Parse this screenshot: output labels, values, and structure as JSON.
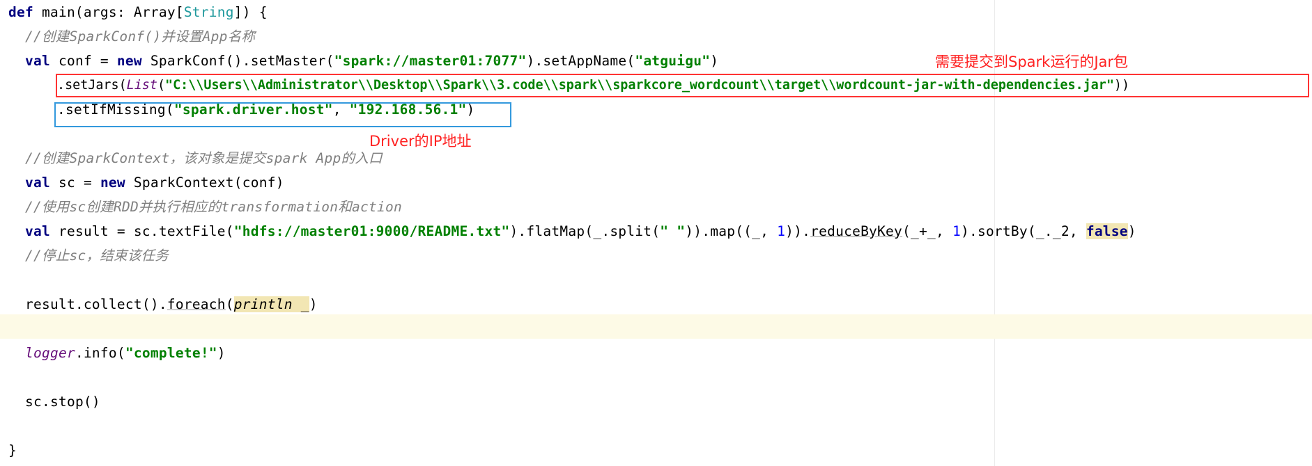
{
  "code": {
    "l1": {
      "def": "def",
      "rest": " main(args: Array[",
      "type": "String",
      "close": "]) {"
    },
    "c1": "//创建SparkConf()并设置App名称",
    "l3": {
      "val": "val",
      "a": " conf = ",
      "new": "new",
      "b": " SparkConf().setMaster(",
      "s1": "\"spark://master01:7077\"",
      "c": ").setAppName(",
      "s2": "\"atguigu\"",
      "d": ")"
    },
    "l4": {
      "a": ".setJars(",
      "list": "List",
      "b": "(",
      "s": "\"C:\\\\Users\\\\Administrator\\\\Desktop\\\\Spark\\\\3.code\\\\spark\\\\sparkcore_wordcount\\\\target\\\\wordcount-jar-with-dependencies.jar\"",
      "c": "))"
    },
    "l5": {
      "a": ".setIfMissing(",
      "s1": "\"spark.driver.host\"",
      "b": ", ",
      "s2": "\"192.168.56.1\"",
      "c": ")"
    },
    "c2": "//创建SparkContext，该对象是提交spark App的入口",
    "l7": {
      "val": "val",
      "a": " sc = ",
      "new": "new",
      "b": " SparkContext(conf)"
    },
    "c3": "//使用sc创建RDD并执行相应的transformation和action",
    "l9": {
      "val": "val",
      "a": " result = sc.textFile(",
      "s1": "\"hdfs://master01:9000/README.txt\"",
      "b": ").flatMap(_.split(",
      "s2": "\" \"",
      "c": ")).map((_, ",
      "n1": "1",
      "d": ")).",
      "rbk": "reduceByKey",
      "e": "(_+_, ",
      "n2": "1",
      "f": ").sortBy(_._2, ",
      "false": "false",
      "g": ")"
    },
    "c4": "//停止sc，结束该任务",
    "l12": {
      "a": "result.collect().",
      "fe": "foreach",
      "b": "(",
      "pl": "println _",
      "c": ")"
    },
    "l14": {
      "lg": "logger",
      "a": ".info(",
      "s": "\"complete!\"",
      "b": ")"
    },
    "l16": "sc.stop()",
    "l18": "}"
  },
  "annotations": {
    "jar_note": "需要提交到Spark运行的Jar包",
    "driver_note": "Driver的IP地址"
  },
  "colors": {
    "keyword": "#000080",
    "string": "#008000",
    "number": "#0000ff",
    "comment": "#808080",
    "type": "#20999d",
    "highlight": "#f2e6b3",
    "caret_row": "#fdfae6",
    "red_box": "#ff3333",
    "blue_box": "#3399dd",
    "note_text": "#ff2222"
  }
}
